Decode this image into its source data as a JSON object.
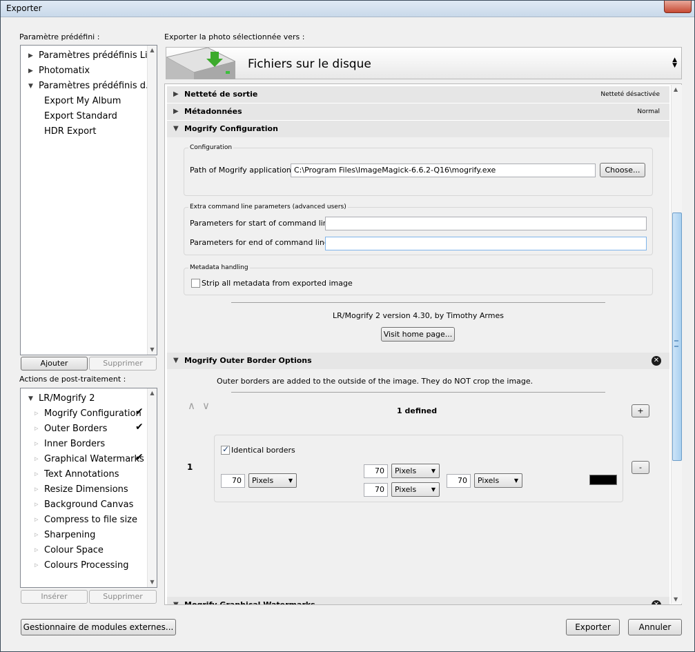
{
  "window": {
    "title": "Exporter"
  },
  "left": {
    "preset_label": "Paramètre prédéfini :",
    "presets": [
      {
        "label": "Paramètres prédéfinis Li...",
        "expanded": false
      },
      {
        "label": "Photomatix",
        "expanded": false
      },
      {
        "label": "Paramètres prédéfinis d...",
        "expanded": true
      }
    ],
    "preset_children": [
      "Export My Album",
      "Export Standard",
      "HDR Export"
    ],
    "add_label": "Ajouter",
    "remove_label": "Supprimer",
    "post_label": "Actions de post-traitement :",
    "post_root": "LR/Mogrify 2",
    "post_items": [
      {
        "label": "Mogrify Configuration",
        "checked": true
      },
      {
        "label": "Outer Borders",
        "checked": true
      },
      {
        "label": "Inner Borders",
        "checked": false
      },
      {
        "label": "Graphical Watermarks",
        "checked": true
      },
      {
        "label": "Text Annotations",
        "checked": false
      },
      {
        "label": "Resize Dimensions",
        "checked": false
      },
      {
        "label": "Background Canvas",
        "checked": false
      },
      {
        "label": "Compress to file size",
        "checked": false
      },
      {
        "label": "Sharpening",
        "checked": false
      },
      {
        "label": "Colour Space",
        "checked": false
      },
      {
        "label": "Colours Processing",
        "checked": false
      }
    ],
    "check_glyph": "✔",
    "insert_label": "Insérer",
    "remove2_label": "Supprimer",
    "plugin_manager_label": "Gestionnaire de modules externes..."
  },
  "top": {
    "export_to_label": "Exporter la photo sélectionnée vers :",
    "destination": "Fichiers sur le disque"
  },
  "sections": {
    "sharpen": {
      "title": "Netteté de sortie",
      "summary": "Netteté désactivée"
    },
    "metadata": {
      "title": "Métadonnées",
      "summary": "Normal"
    },
    "mogrify_config": {
      "title": "Mogrify Configuration"
    }
  },
  "config": {
    "group_title": "Configuration",
    "path_label": "Path of Mogrify application:",
    "path_value": "C:\\Program Files\\ImageMagick-6.6.2-Q16\\mogrify.exe",
    "choose_label": "Choose...",
    "extra_title": "Extra command line parameters (advanced users)",
    "start_label": "Parameters for start of command line:",
    "start_value": "",
    "end_label": "Parameters for end of command line:",
    "end_value": "",
    "meta_title": "Metadata handling",
    "strip_label": "Strip all metadata from exported image",
    "strip_checked": false,
    "version_text": "LR/Mogrify 2 version 4.30, by Timothy Armes",
    "home_label": "Visit home page..."
  },
  "outer": {
    "title": "Mogrify Outer Border Options",
    "description": "Outer borders are added to the outside of the image.  They do NOT crop the image.",
    "defined_text": "1 defined",
    "plus_label": "+",
    "minus_label": "-",
    "row_number": "1",
    "identical_label": "Identical borders",
    "identical_checked": true,
    "left": {
      "value": "70",
      "unit": "Pixels"
    },
    "top": {
      "value": "70",
      "unit": "Pixels"
    },
    "bottom": {
      "value": "70",
      "unit": "Pixels"
    },
    "right": {
      "value": "70",
      "unit": "Pixels"
    },
    "color": "#000000"
  },
  "next_section": {
    "title": "Mogrify Graphical Watermarks"
  },
  "footer": {
    "export_label": "Exporter",
    "cancel_label": "Annuler"
  }
}
